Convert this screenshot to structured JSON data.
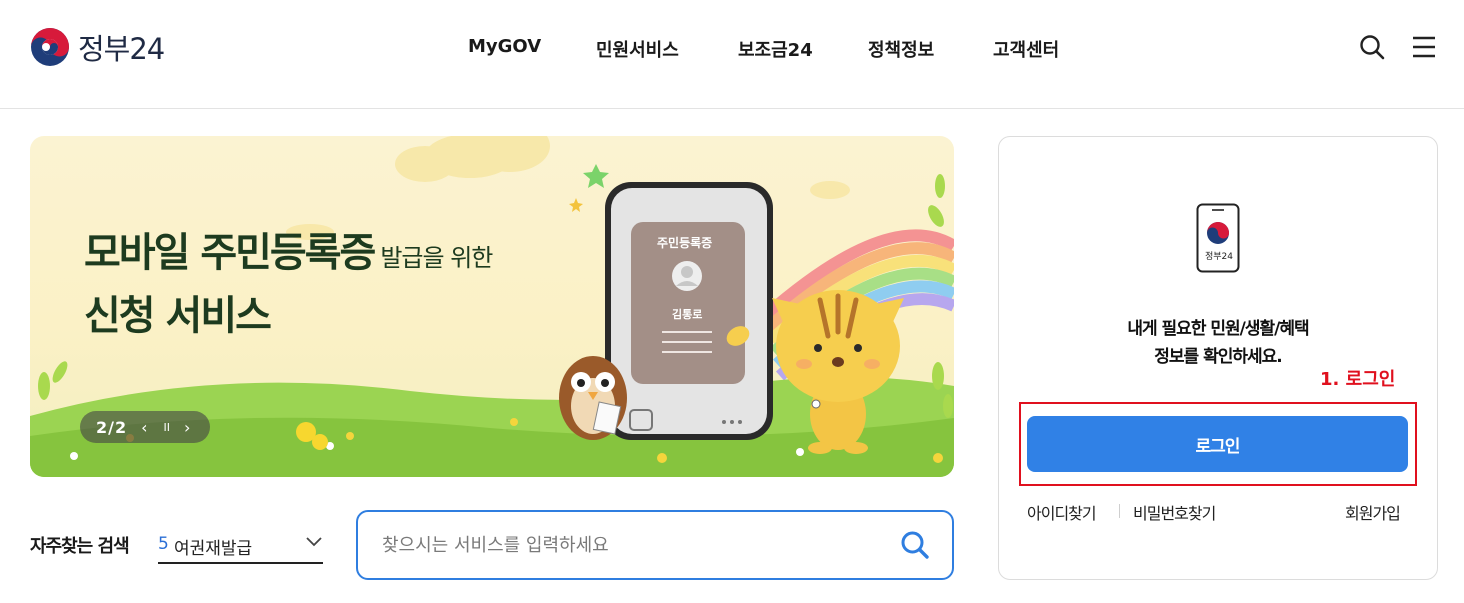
{
  "header": {
    "logo_text": "정부24",
    "nav": [
      "MyGOV",
      "민원서비스",
      "보조금24",
      "정책정보",
      "고객센터"
    ],
    "icons": [
      "search-icon",
      "hamburger-menu-icon"
    ]
  },
  "banner": {
    "title_line1": "모바일 주민등록증",
    "title_line1_small": "발급을 위한",
    "title_line2": "신청 서비스",
    "card_title": "주민등록증",
    "card_name": "김통로",
    "pager_text": "2/2",
    "pager_prev": "‹",
    "pager_pause": "II",
    "pager_next": "›"
  },
  "frequent": {
    "label": "자주찾는 검색",
    "rank": "5",
    "keyword": "여권재발급"
  },
  "search": {
    "placeholder": "찾으시는 서비스를 입력하세요"
  },
  "login": {
    "phone_logo_text": "정부24",
    "message_line1": "내게 필요한 민원/생활/혜택",
    "message_line2": "정보를 확인하세요.",
    "annotation": "1. 로그인",
    "button_label": "로그인",
    "find_id": "아이디찾기",
    "find_pw": "비밀번호찾기",
    "signup": "회원가입"
  },
  "colors": {
    "accent_blue": "#3081e6",
    "annotation_red": "#e0101e",
    "banner_text_green": "#1d3b1f"
  }
}
